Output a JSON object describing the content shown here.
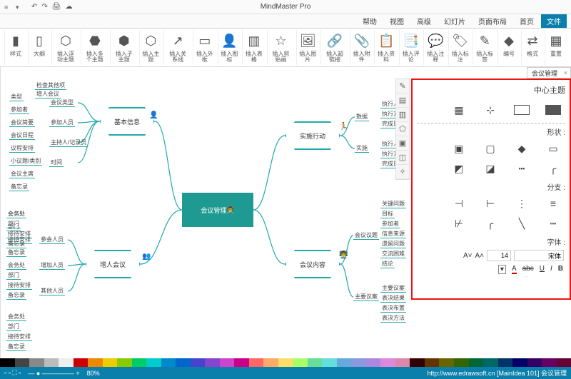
{
  "app_title": "MindMaster Pro",
  "tabs": [
    "文件",
    "首页",
    "页面布局",
    "幻灯片",
    "高级",
    "视图",
    "帮助"
  ],
  "ribbon": [
    {
      "icon": "▦",
      "label": "重置"
    },
    {
      "icon": "⇄",
      "label": "格式"
    },
    {
      "icon": "◆",
      "label": "编号"
    },
    {
      "icon": "✎",
      "label": "插入标签"
    },
    {
      "icon": "🏷",
      "label": "插入标注"
    },
    {
      "icon": "💬",
      "label": "插入注释"
    },
    {
      "icon": "📑",
      "label": "插入评论"
    },
    {
      "icon": "📋",
      "label": "插入资料"
    },
    {
      "icon": "📎",
      "label": "插入附件"
    },
    {
      "icon": "🔗",
      "label": "插入超链接"
    },
    {
      "icon": "🖼",
      "label": "插入图片"
    },
    {
      "icon": "☆",
      "label": "插入剪贴画"
    },
    {
      "icon": "▥",
      "label": "插入表格"
    },
    {
      "icon": "👤",
      "label": "插入图标"
    },
    {
      "icon": "▭",
      "label": "插入外框"
    },
    {
      "icon": "↗",
      "label": "插入关系线"
    },
    {
      "icon": "⬡",
      "label": "插入主题"
    },
    {
      "icon": "⬢",
      "label": "插入子主题"
    },
    {
      "icon": "⬣",
      "label": "插入多个主题"
    },
    {
      "icon": "⬡",
      "label": "插入浮动主题"
    },
    {
      "icon": "▯",
      "label": "大纲"
    },
    {
      "icon": "▮",
      "label": "样式"
    }
  ],
  "doc_tab": "会议管理",
  "sidepanel": {
    "title": "中心主题",
    "section_shapes": "形状 :",
    "section_branch": "分支 :",
    "section_font": "字体 :",
    "font_name": "宋体",
    "font_size": "14",
    "fmt": [
      "B",
      "I",
      "U",
      "abc",
      "A"
    ]
  },
  "center": "会议管理",
  "hex": {
    "info": "基本信息",
    "person": "增人会议",
    "action": "实施行动",
    "content": "会议内容"
  },
  "info_children": [
    "会议类型",
    "参加人员",
    "主持人/记录员",
    "时间"
  ],
  "info_sub": [
    "类型",
    "参加者",
    "会议简要",
    "会议日程",
    "议程安排",
    "小议题/类别",
    "会议主席",
    "备忘录"
  ],
  "info_top": [
    "检查其他项",
    "增人会议"
  ],
  "person_children": [
    "参会人员",
    "增加人员",
    "其他人员"
  ],
  "person_sub": [
    "会务处",
    "部门",
    "接待安排",
    "备忘录"
  ],
  "action_children": [
    "数据",
    "实施"
  ],
  "action_sub": [
    "执行人",
    "执行方案",
    "完成日期"
  ],
  "content_children": [
    "会议议题",
    "主要议案"
  ],
  "content_sub_a": [
    "关键问题",
    "目标",
    "参加者",
    "信息来源",
    "遗留问题",
    "交流困难",
    "结论"
  ],
  "content_sub_b": [
    "主要议案",
    "表决结果",
    "表决布置",
    "表决方法"
  ],
  "status": {
    "path": "http://www.edrawsoft.cn [MainIdea 101] 会议管理",
    "zoom": "80%"
  },
  "colors": [
    "#000",
    "#444",
    "#888",
    "#bbb",
    "#eee",
    "#c00",
    "#e80",
    "#ec0",
    "#8c0",
    "#0c6",
    "#0cc",
    "#08c",
    "#06c",
    "#44c",
    "#84c",
    "#c4c",
    "#c08",
    "#f66",
    "#fa6",
    "#fd6",
    "#af6",
    "#6d9",
    "#6dd",
    "#6ad",
    "#89d",
    "#a8d",
    "#d8d",
    "#d8a",
    "#300",
    "#630",
    "#660",
    "#360",
    "#063",
    "#066",
    "#036",
    "#006",
    "#306",
    "#606",
    "#603"
  ]
}
